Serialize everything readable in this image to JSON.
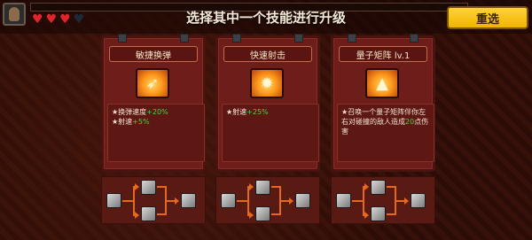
{
  "header": {
    "title": "选择其中一个技能进行升级",
    "reroll_label": "重选",
    "hearts": [
      "full",
      "full",
      "full",
      "empty"
    ]
  },
  "cards": [
    {
      "name": "敏捷换弹",
      "icon": "rapid-reload-icon",
      "lines": [
        {
          "text": "★换弹速度",
          "bonus": "+20%"
        },
        {
          "text": "★射速",
          "bonus": "+5%"
        }
      ]
    },
    {
      "name": "快速射击",
      "icon": "rapid-fire-icon",
      "lines": [
        {
          "text": "★射速",
          "bonus": "+25%"
        }
      ]
    },
    {
      "name": "量子矩阵 lv.1",
      "icon": "quantum-matrix-icon",
      "desc_pre": "★召唤一个量子矩阵伴你左右对碰撞的敌人造成",
      "desc_num": "20",
      "desc_post": "点伤害"
    }
  ],
  "colors": {
    "accent_gold": "#f0b400",
    "bonus_green": "#3fd43f",
    "card_red": "#6d1e1a"
  }
}
